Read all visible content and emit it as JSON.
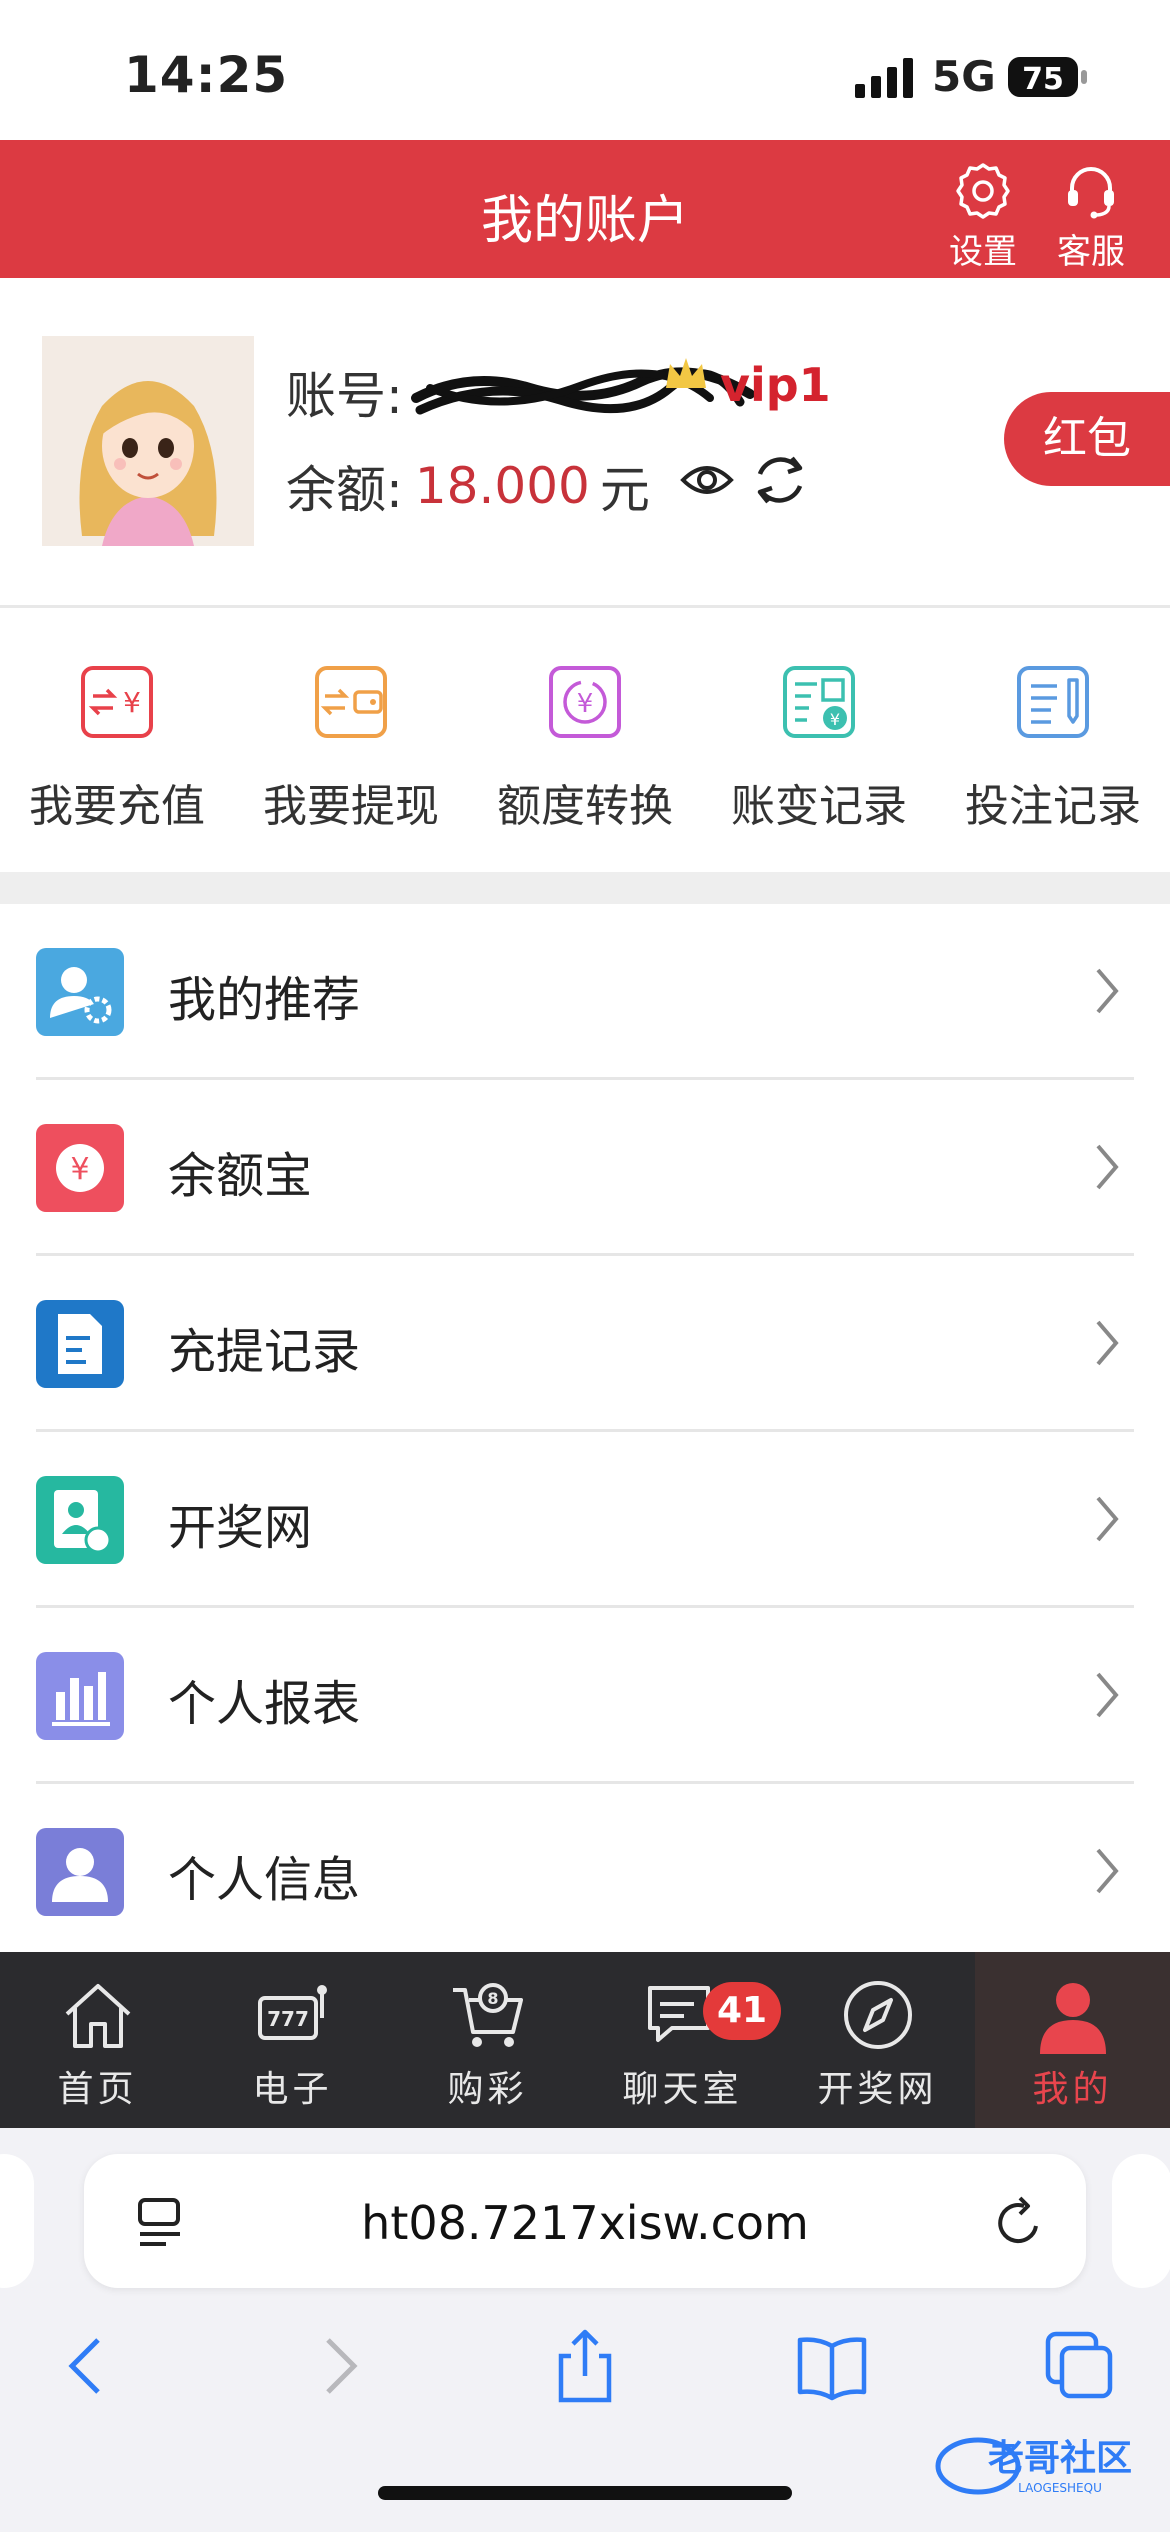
{
  "status_bar": {
    "time": "14:25",
    "network": "5G",
    "battery": "75"
  },
  "header": {
    "title": "我的账户",
    "settings_label": "设置",
    "service_label": "客服"
  },
  "account": {
    "account_label": "账号:",
    "vip_level": "vip1",
    "balance_label": "余额:",
    "balance_value": "18.000",
    "currency": "元",
    "red_packet_label": "红包"
  },
  "quick_actions": [
    {
      "label": "我要充值",
      "icon": "deposit-icon",
      "color": "#e8414a"
    },
    {
      "label": "我要提现",
      "icon": "withdraw-icon",
      "color": "#f0a048"
    },
    {
      "label": "额度转换",
      "icon": "transfer-icon",
      "color": "#c45ad8"
    },
    {
      "label": "账变记录",
      "icon": "account-change-icon",
      "color": "#3cc0b0"
    },
    {
      "label": "投注记录",
      "icon": "bet-record-icon",
      "color": "#5a9ae0"
    }
  ],
  "menu": [
    {
      "label": "我的推荐",
      "icon": "referral-icon",
      "color": "#4aa8e0"
    },
    {
      "label": "余额宝",
      "icon": "yuebao-icon",
      "color": "#ee4f5e"
    },
    {
      "label": "充提记录",
      "icon": "deposit-withdraw-record-icon",
      "color": "#1f78c8"
    },
    {
      "label": "开奖网",
      "icon": "lottery-results-icon",
      "color": "#26b8a0"
    },
    {
      "label": "个人报表",
      "icon": "report-icon",
      "color": "#8a8ee8"
    },
    {
      "label": "个人信息",
      "icon": "profile-icon",
      "color": "#7a7ed8"
    }
  ],
  "tabbar": {
    "items": [
      {
        "label": "首页",
        "icon": "home-icon"
      },
      {
        "label": "电子",
        "icon": "slot-machine-icon"
      },
      {
        "label": "购彩",
        "icon": "lottery-cart-icon"
      },
      {
        "label": "聊天室",
        "icon": "chat-icon"
      },
      {
        "label": "开奖网",
        "icon": "compass-icon"
      },
      {
        "label": "我的",
        "icon": "user-icon"
      }
    ],
    "chat_badge": "41",
    "active": "我的"
  },
  "browser": {
    "url": "ht08.7217xisw.com"
  },
  "watermark": {
    "text": "老哥社区",
    "subtext": "LAOGESHEQU"
  },
  "colors": {
    "brand_red": "#dc3a42",
    "amount_red": "#c8323a",
    "tabbar_bg": "#2b2b2e"
  }
}
